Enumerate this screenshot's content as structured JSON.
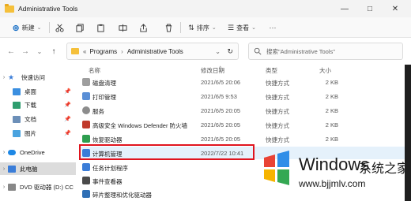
{
  "window": {
    "title": "Administrative Tools",
    "min": "—",
    "max": "□",
    "close": "✕"
  },
  "toolbar": {
    "new_label": "新建",
    "sort_label": "排序",
    "view_label": "查看",
    "more": "···"
  },
  "nav": {
    "back": "←",
    "forward": "→",
    "recent": "⌄",
    "up": "↑"
  },
  "address": {
    "prefix": "«",
    "crumbs": [
      "Programs",
      "Administrative Tools"
    ],
    "sep": "›",
    "dropdown": "⌄",
    "refresh": "↻"
  },
  "search": {
    "placeholder": "搜索\"Administrative Tools\""
  },
  "sidebar": {
    "items": [
      {
        "label": "快速访问",
        "chev": "›",
        "expanded": true
      },
      {
        "label": "桌面",
        "pinned": true
      },
      {
        "label": "下载",
        "pinned": true
      },
      {
        "label": "文档",
        "pinned": true
      },
      {
        "label": "图片",
        "pinned": true
      },
      {
        "label": "OneDrive",
        "chev": "›"
      },
      {
        "label": "此电脑",
        "chev": "›",
        "selected": true
      },
      {
        "label": "DVD 驱动器 (D:) CC",
        "chev": "›"
      }
    ]
  },
  "columns": {
    "name": "名称",
    "date": "修改日期",
    "type": "类型",
    "size": "大小"
  },
  "files": [
    {
      "name": "磁盘清理",
      "date": "2021/6/5 20:06",
      "type": "快捷方式",
      "size": "2 KB",
      "icon_color": "#9e9e9e"
    },
    {
      "name": "打印管理",
      "date": "2021/6/5 9:53",
      "type": "快捷方式",
      "size": "2 KB",
      "icon_color": "#5a8fd6"
    },
    {
      "name": "服务",
      "date": "2021/6/5 20:05",
      "type": "快捷方式",
      "size": "2 KB",
      "icon_color": "#8c8c8c"
    },
    {
      "name": "高级安全 Windows Defender 防火墙",
      "date": "2021/6/5 20:05",
      "type": "快捷方式",
      "size": "2 KB",
      "icon_color": "#c0392b"
    },
    {
      "name": "恢复驱动器",
      "date": "2021/6/5 20:05",
      "type": "快捷方式",
      "size": "2 KB",
      "icon_color": "#2e9e4f"
    },
    {
      "name": "计算机管理",
      "date": "2022/7/22 10:41",
      "type": "",
      "size": "",
      "icon_color": "#3b7dd8",
      "selected": true
    },
    {
      "name": "任务计划程序",
      "date": "",
      "type": "",
      "size": "",
      "icon_color": "#3b7dd8"
    },
    {
      "name": "事件查看器",
      "date": "",
      "type": "",
      "size": "",
      "icon_color": "#4a4a4a"
    },
    {
      "name": "碎片整理和优化驱动器",
      "date": "",
      "type": "",
      "size": "",
      "icon_color": "#2f6fb5"
    }
  ],
  "watermark": {
    "brand": "Windows",
    "cn": "系统之家",
    "url": "www.bjjmlv.com"
  },
  "colors": {
    "accent": "#0a66c2",
    "highlight": "#e0141e",
    "folder": "#f5c03a"
  }
}
